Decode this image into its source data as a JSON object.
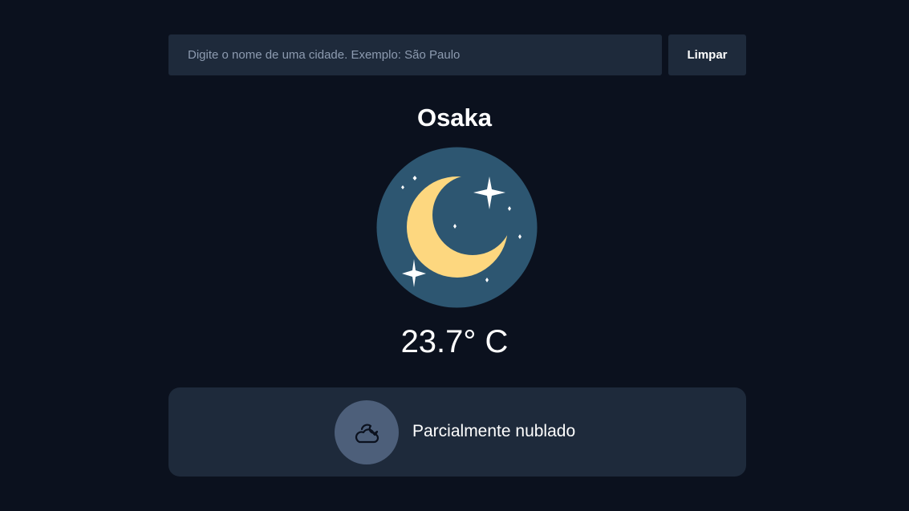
{
  "search": {
    "placeholder": "Digite o nome de uma cidade. Exemplo: São Paulo",
    "value": "",
    "clear_label": "Limpar"
  },
  "weather": {
    "city": "Osaka",
    "temperature": "23.7° C",
    "condition": "Parcialmente nublado",
    "main_icon": "moon-stars-icon",
    "condition_icon": "partly-cloudy-night-icon"
  },
  "colors": {
    "background": "#0b111e",
    "panel": "#1e2a3b",
    "moon_circle": "#2d5671",
    "moon": "#fdd77f",
    "condition_icon_bg": "#4d5f7a"
  }
}
